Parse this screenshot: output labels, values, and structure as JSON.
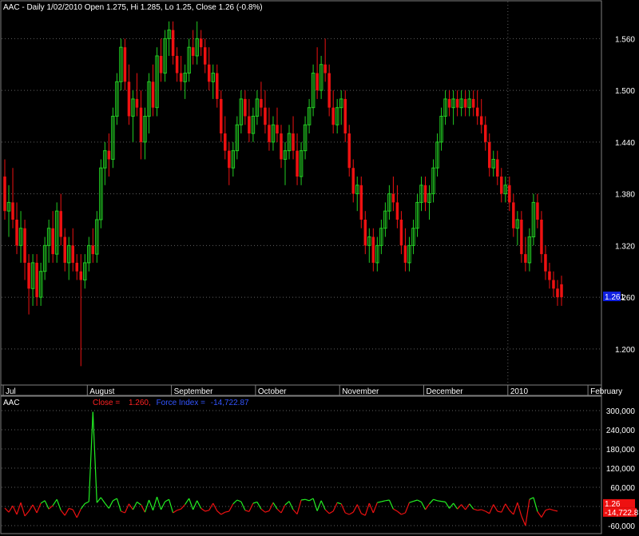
{
  "symbol": "AAC",
  "header_text": "AAC - Daily 1/02/2010 Open 1.275, Hi 1.285, Lo 1.25, Close 1.26 (-0.8%)",
  "colors": {
    "background": "#000000",
    "frame": "#808080",
    "grid": "#606060",
    "up": "#22cc22",
    "down": "#ee1111",
    "text": "#ffffff",
    "close_label": "#ff2222",
    "force_label": "#3355ff",
    "price_marker_bg": "#1020e0",
    "force_marker_bg": "#ee1111",
    "force_line_pos": "#22ee22",
    "force_line_neg": "#ee1111"
  },
  "chart_data": [
    {
      "type": "candlestick",
      "title": "AAC - Daily 1/02/2010 Open 1.275, Hi 1.285, Lo 1.25, Close 1.26 (-0.8%)",
      "ylim": [
        1.16,
        1.59
      ],
      "y_ticks": [
        "1.560",
        "1.500",
        "1.440",
        "1.380",
        "1.320",
        "1.260",
        "1.200"
      ],
      "y_tick_values": [
        1.56,
        1.5,
        1.44,
        1.38,
        1.32,
        1.26,
        1.2
      ],
      "x_labels": [
        "Jul",
        "August",
        "September",
        "October",
        "November",
        "December",
        "2010",
        "February"
      ],
      "x_label_index": [
        0,
        21,
        42,
        63,
        84,
        105,
        126,
        146
      ],
      "last_value_label": "1.261",
      "last_value": 1.261,
      "series": [
        {
          "name": "AAC",
          "ohlc": [
            [
              1.4,
              1.42,
              1.35,
              1.36
            ],
            [
              1.36,
              1.39,
              1.33,
              1.37
            ],
            [
              1.37,
              1.41,
              1.34,
              1.35
            ],
            [
              1.35,
              1.37,
              1.31,
              1.32
            ],
            [
              1.32,
              1.36,
              1.3,
              1.34
            ],
            [
              1.34,
              1.35,
              1.28,
              1.3
            ],
            [
              1.3,
              1.31,
              1.24,
              1.27
            ],
            [
              1.27,
              1.31,
              1.25,
              1.3
            ],
            [
              1.3,
              1.31,
              1.25,
              1.26
            ],
            [
              1.26,
              1.3,
              1.25,
              1.29
            ],
            [
              1.29,
              1.33,
              1.28,
              1.32
            ],
            [
              1.32,
              1.35,
              1.3,
              1.34
            ],
            [
              1.34,
              1.36,
              1.3,
              1.31
            ],
            [
              1.31,
              1.37,
              1.3,
              1.36
            ],
            [
              1.36,
              1.38,
              1.32,
              1.33
            ],
            [
              1.33,
              1.34,
              1.29,
              1.3
            ],
            [
              1.3,
              1.33,
              1.28,
              1.32
            ],
            [
              1.32,
              1.34,
              1.29,
              1.3
            ],
            [
              1.3,
              1.31,
              1.28,
              1.29
            ],
            [
              1.29,
              1.31,
              1.18,
              1.28
            ],
            [
              1.28,
              1.31,
              1.27,
              1.3
            ],
            [
              1.3,
              1.33,
              1.29,
              1.32
            ],
            [
              1.32,
              1.34,
              1.3,
              1.31
            ],
            [
              1.31,
              1.36,
              1.3,
              1.35
            ],
            [
              1.35,
              1.42,
              1.34,
              1.41
            ],
            [
              1.41,
              1.44,
              1.39,
              1.43
            ],
            [
              1.43,
              1.45,
              1.4,
              1.42
            ],
            [
              1.42,
              1.48,
              1.41,
              1.47
            ],
            [
              1.47,
              1.52,
              1.46,
              1.51
            ],
            [
              1.51,
              1.56,
              1.5,
              1.55
            ],
            [
              1.55,
              1.56,
              1.5,
              1.51
            ],
            [
              1.51,
              1.53,
              1.46,
              1.47
            ],
            [
              1.47,
              1.5,
              1.44,
              1.49
            ],
            [
              1.49,
              1.52,
              1.47,
              1.48
            ],
            [
              1.48,
              1.5,
              1.42,
              1.44
            ],
            [
              1.44,
              1.48,
              1.42,
              1.47
            ],
            [
              1.47,
              1.52,
              1.45,
              1.51
            ],
            [
              1.51,
              1.53,
              1.47,
              1.48
            ],
            [
              1.48,
              1.55,
              1.47,
              1.54
            ],
            [
              1.54,
              1.56,
              1.51,
              1.52
            ],
            [
              1.52,
              1.57,
              1.51,
              1.56
            ],
            [
              1.56,
              1.58,
              1.54,
              1.57
            ],
            [
              1.57,
              1.58,
              1.53,
              1.54
            ],
            [
              1.54,
              1.55,
              1.51,
              1.52
            ],
            [
              1.52,
              1.54,
              1.5,
              1.51
            ],
            [
              1.51,
              1.53,
              1.49,
              1.52
            ],
            [
              1.52,
              1.56,
              1.51,
              1.55
            ],
            [
              1.55,
              1.57,
              1.53,
              1.54
            ],
            [
              1.54,
              1.58,
              1.53,
              1.56
            ],
            [
              1.56,
              1.57,
              1.54,
              1.55
            ],
            [
              1.55,
              1.56,
              1.52,
              1.53
            ],
            [
              1.53,
              1.55,
              1.5,
              1.51
            ],
            [
              1.51,
              1.53,
              1.49,
              1.52
            ],
            [
              1.52,
              1.53,
              1.48,
              1.49
            ],
            [
              1.49,
              1.5,
              1.44,
              1.45
            ],
            [
              1.45,
              1.47,
              1.42,
              1.43
            ],
            [
              1.43,
              1.44,
              1.39,
              1.41
            ],
            [
              1.41,
              1.44,
              1.4,
              1.43
            ],
            [
              1.43,
              1.47,
              1.42,
              1.46
            ],
            [
              1.46,
              1.5,
              1.45,
              1.49
            ],
            [
              1.49,
              1.5,
              1.46,
              1.47
            ],
            [
              1.47,
              1.49,
              1.44,
              1.45
            ],
            [
              1.45,
              1.48,
              1.44,
              1.47
            ],
            [
              1.47,
              1.5,
              1.46,
              1.49
            ],
            [
              1.49,
              1.51,
              1.47,
              1.48
            ],
            [
              1.48,
              1.5,
              1.45,
              1.46
            ],
            [
              1.46,
              1.48,
              1.43,
              1.44
            ],
            [
              1.44,
              1.47,
              1.43,
              1.46
            ],
            [
              1.46,
              1.48,
              1.44,
              1.45
            ],
            [
              1.45,
              1.46,
              1.41,
              1.42
            ],
            [
              1.42,
              1.44,
              1.39,
              1.43
            ],
            [
              1.43,
              1.46,
              1.42,
              1.45
            ],
            [
              1.45,
              1.47,
              1.42,
              1.43
            ],
            [
              1.43,
              1.45,
              1.39,
              1.4
            ],
            [
              1.4,
              1.44,
              1.39,
              1.43
            ],
            [
              1.43,
              1.47,
              1.42,
              1.46
            ],
            [
              1.46,
              1.49,
              1.45,
              1.48
            ],
            [
              1.48,
              1.53,
              1.47,
              1.52
            ],
            [
              1.52,
              1.55,
              1.49,
              1.5
            ],
            [
              1.5,
              1.54,
              1.49,
              1.53
            ],
            [
              1.53,
              1.56,
              1.51,
              1.52
            ],
            [
              1.52,
              1.53,
              1.47,
              1.48
            ],
            [
              1.48,
              1.5,
              1.45,
              1.46
            ],
            [
              1.46,
              1.49,
              1.45,
              1.48
            ],
            [
              1.48,
              1.5,
              1.46,
              1.49
            ],
            [
              1.49,
              1.5,
              1.44,
              1.45
            ],
            [
              1.45,
              1.46,
              1.4,
              1.41
            ],
            [
              1.41,
              1.42,
              1.37,
              1.38
            ],
            [
              1.38,
              1.4,
              1.36,
              1.39
            ],
            [
              1.39,
              1.4,
              1.34,
              1.35
            ],
            [
              1.35,
              1.36,
              1.31,
              1.32
            ],
            [
              1.32,
              1.34,
              1.3,
              1.33
            ],
            [
              1.33,
              1.34,
              1.29,
              1.3
            ],
            [
              1.3,
              1.33,
              1.29,
              1.32
            ],
            [
              1.32,
              1.35,
              1.31,
              1.34
            ],
            [
              1.34,
              1.37,
              1.33,
              1.36
            ],
            [
              1.36,
              1.39,
              1.35,
              1.38
            ],
            [
              1.38,
              1.4,
              1.36,
              1.37
            ],
            [
              1.37,
              1.39,
              1.34,
              1.35
            ],
            [
              1.35,
              1.36,
              1.31,
              1.32
            ],
            [
              1.32,
              1.34,
              1.29,
              1.3
            ],
            [
              1.3,
              1.33,
              1.29,
              1.32
            ],
            [
              1.32,
              1.35,
              1.31,
              1.34
            ],
            [
              1.34,
              1.38,
              1.33,
              1.37
            ],
            [
              1.37,
              1.4,
              1.36,
              1.39
            ],
            [
              1.39,
              1.4,
              1.36,
              1.37
            ],
            [
              1.37,
              1.39,
              1.35,
              1.38
            ],
            [
              1.38,
              1.42,
              1.37,
              1.41
            ],
            [
              1.41,
              1.45,
              1.4,
              1.44
            ],
            [
              1.44,
              1.48,
              1.43,
              1.47
            ],
            [
              1.47,
              1.5,
              1.46,
              1.49
            ],
            [
              1.49,
              1.5,
              1.47,
              1.48
            ],
            [
              1.48,
              1.5,
              1.46,
              1.49
            ],
            [
              1.49,
              1.5,
              1.47,
              1.48
            ],
            [
              1.48,
              1.5,
              1.47,
              1.49
            ],
            [
              1.49,
              1.5,
              1.47,
              1.48
            ],
            [
              1.48,
              1.5,
              1.47,
              1.49
            ],
            [
              1.49,
              1.5,
              1.47,
              1.48
            ],
            [
              1.48,
              1.5,
              1.46,
              1.47
            ],
            [
              1.47,
              1.49,
              1.45,
              1.46
            ],
            [
              1.46,
              1.47,
              1.43,
              1.44
            ],
            [
              1.44,
              1.45,
              1.4,
              1.41
            ],
            [
              1.41,
              1.43,
              1.4,
              1.42
            ],
            [
              1.42,
              1.43,
              1.39,
              1.4
            ],
            [
              1.4,
              1.41,
              1.37,
              1.38
            ],
            [
              1.38,
              1.4,
              1.37,
              1.39
            ],
            [
              1.39,
              1.4,
              1.36,
              1.37
            ],
            [
              1.37,
              1.38,
              1.33,
              1.34
            ],
            [
              1.34,
              1.36,
              1.32,
              1.35
            ],
            [
              1.35,
              1.36,
              1.3,
              1.31
            ],
            [
              1.31,
              1.33,
              1.29,
              1.3
            ],
            [
              1.3,
              1.34,
              1.29,
              1.33
            ],
            [
              1.33,
              1.38,
              1.32,
              1.37
            ],
            [
              1.37,
              1.38,
              1.34,
              1.35
            ],
            [
              1.35,
              1.36,
              1.3,
              1.31
            ],
            [
              1.31,
              1.32,
              1.28,
              1.29
            ],
            [
              1.29,
              1.3,
              1.27,
              1.28
            ],
            [
              1.28,
              1.29,
              1.26,
              1.27
            ],
            [
              1.27,
              1.28,
              1.25,
              1.26
            ],
            [
              1.275,
              1.285,
              1.25,
              1.26
            ]
          ]
        }
      ]
    },
    {
      "type": "line",
      "title": "AAC",
      "legend": {
        "close_label": "Close =",
        "close_value": "1.260,",
        "force_label": "Force Index =",
        "force_value": "-14,722.87"
      },
      "ylim": [
        -75000,
        310000
      ],
      "y_ticks": [
        "300,000",
        "240,000",
        "180,000",
        "120,000",
        "60,000",
        "-60,000"
      ],
      "y_tick_values": [
        300000,
        240000,
        180000,
        120000,
        60000,
        -60000
      ],
      "marker_close": "1.26",
      "marker_force": "-14,722.8",
      "marker_force_value": -14722.87,
      "series": [
        {
          "name": "Force Index",
          "values": [
            -5000,
            -18000,
            2000,
            -25000,
            12000,
            -30000,
            -15000,
            5000,
            -20000,
            10000,
            18000,
            -8000,
            3000,
            22000,
            -12000,
            -28000,
            -6000,
            -10000,
            -35000,
            -8000,
            9000,
            15000,
            296000,
            12000,
            28000,
            10000,
            -6000,
            18000,
            25000,
            -15000,
            -20000,
            8000,
            -10000,
            14000,
            5000,
            -18000,
            20000,
            -12000,
            30000,
            -10000,
            15000,
            22000,
            -20000,
            -12000,
            -8000,
            6000,
            25000,
            -10000,
            18000,
            -6000,
            -15000,
            -12000,
            10000,
            -14000,
            -25000,
            -18000,
            -15000,
            8000,
            20000,
            15000,
            -12000,
            -16000,
            10000,
            14000,
            -8000,
            -18000,
            -14000,
            12000,
            -8000,
            -20000,
            5000,
            16000,
            -10000,
            -24000,
            20000,
            22000,
            18000,
            25000,
            -14000,
            18000,
            -10000,
            -22000,
            -15000,
            12000,
            8000,
            -20000,
            -25000,
            -18000,
            6000,
            -22000,
            -28000,
            10000,
            -20000,
            12000,
            15000,
            18000,
            20000,
            -8000,
            -15000,
            -25000,
            -20000,
            12000,
            16000,
            20000,
            14000,
            -10000,
            8000,
            22000,
            18000,
            16000,
            14000,
            -6000,
            10000,
            -8000,
            6000,
            -10000,
            8000,
            -8000,
            -12000,
            -10000,
            -15000,
            -22000,
            6000,
            -15000,
            -18000,
            8000,
            -12000,
            -25000,
            12000,
            -30000,
            -60000,
            22000,
            28000,
            -16000,
            -34000,
            -12000,
            -8000,
            -12000,
            -14722
          ]
        }
      ]
    }
  ]
}
